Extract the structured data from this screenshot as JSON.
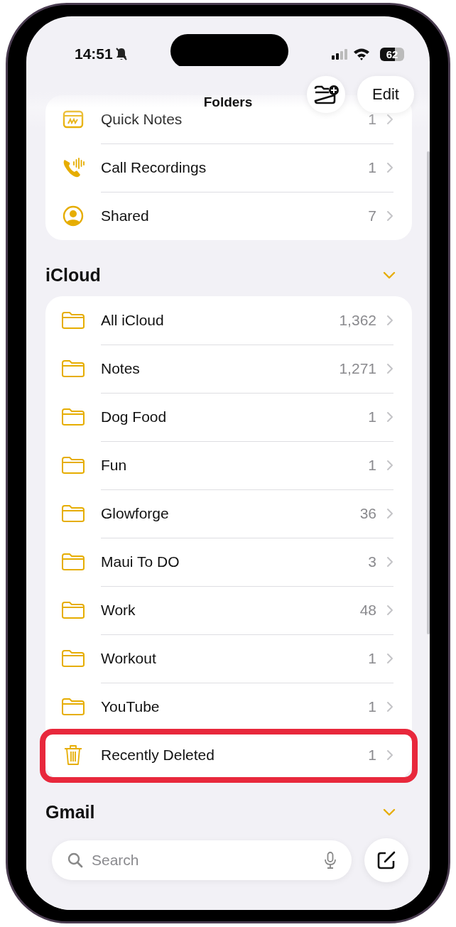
{
  "status_bar": {
    "time": "14:51",
    "battery": "62"
  },
  "nav": {
    "title": "Folders",
    "edit": "Edit"
  },
  "sections": [
    {
      "kind": "plain",
      "items": [
        {
          "kind": "quick-notes",
          "name": "Quick Notes",
          "count": "1",
          "highlighted": false
        },
        {
          "kind": "phone",
          "name": "Call Recordings",
          "count": "1",
          "highlighted": false
        },
        {
          "kind": "person",
          "name": "Shared",
          "count": "7",
          "highlighted": false
        }
      ]
    },
    {
      "kind": "account",
      "title": "iCloud",
      "expanded": true,
      "items": [
        {
          "kind": "folder",
          "name": "All iCloud",
          "count": "1,362",
          "highlighted": false
        },
        {
          "kind": "folder",
          "name": "Notes",
          "count": "1,271",
          "highlighted": false
        },
        {
          "kind": "folder",
          "name": "Dog Food",
          "count": "1",
          "highlighted": false
        },
        {
          "kind": "folder",
          "name": "Fun",
          "count": "1",
          "highlighted": false
        },
        {
          "kind": "folder",
          "name": "Glowforge",
          "count": "36",
          "highlighted": false
        },
        {
          "kind": "folder",
          "name": "Maui To DO",
          "count": "3",
          "highlighted": false
        },
        {
          "kind": "folder",
          "name": "Work",
          "count": "48",
          "highlighted": false
        },
        {
          "kind": "folder",
          "name": "Workout",
          "count": "1",
          "highlighted": false
        },
        {
          "kind": "folder",
          "name": "YouTube",
          "count": "1",
          "highlighted": false
        },
        {
          "kind": "trash",
          "name": "Recently Deleted",
          "count": "1",
          "highlighted": true
        }
      ]
    },
    {
      "kind": "account",
      "title": "Gmail",
      "expanded": true
    }
  ],
  "search": {
    "placeholder": "Search"
  }
}
